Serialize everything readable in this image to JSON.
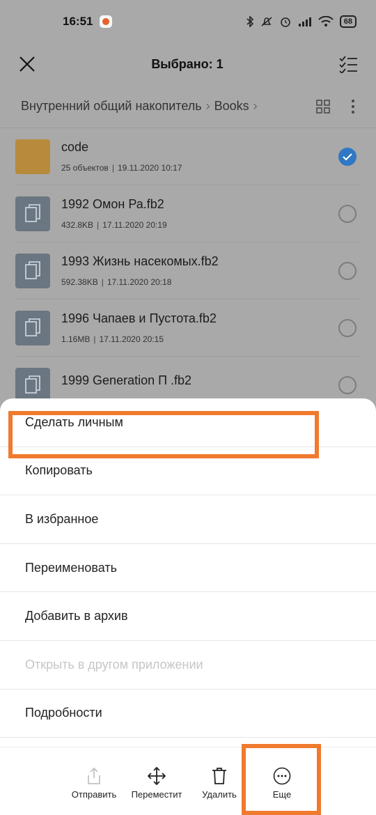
{
  "status_bar": {
    "time": "16:51",
    "battery": "68"
  },
  "top_bar": {
    "title": "Выбрано: 1"
  },
  "breadcrumb": {
    "root": "Внутренний общий накопитель",
    "current": "Books"
  },
  "files": [
    {
      "name": "code",
      "meta1": "25 объектов",
      "meta2": "19.11.2020 10:17",
      "type": "folder",
      "selected": true
    },
    {
      "name": "1992 Омон Ра.fb2",
      "meta1": "432.8KB",
      "meta2": "17.11.2020 20:19",
      "type": "doc",
      "selected": false
    },
    {
      "name": "1993 Жизнь насекомых.fb2",
      "meta1": "592.38KB",
      "meta2": "17.11.2020 20:18",
      "type": "doc",
      "selected": false
    },
    {
      "name": "1996 Чапаев и Пустота.fb2",
      "meta1": "1.16MB",
      "meta2": "17.11.2020 20:15",
      "type": "doc",
      "selected": false
    },
    {
      "name": "1999 Generation П .fb2",
      "meta1": "",
      "meta2": "",
      "type": "doc",
      "selected": false
    }
  ],
  "menu": {
    "items": [
      {
        "label": "Сделать личным"
      },
      {
        "label": "Копировать"
      },
      {
        "label": "В избранное"
      },
      {
        "label": "Переименовать"
      },
      {
        "label": "Добавить в архив"
      },
      {
        "label": "Открыть в другом приложении"
      },
      {
        "label": "Подробности"
      }
    ]
  },
  "toolbar": {
    "send": "Отправить",
    "move": "Переместит",
    "delete": "Удалить",
    "more": "Еще"
  },
  "colors": {
    "accent": "#2f78c4",
    "highlight": "#f07a2d",
    "folder": "#b88a3b"
  }
}
